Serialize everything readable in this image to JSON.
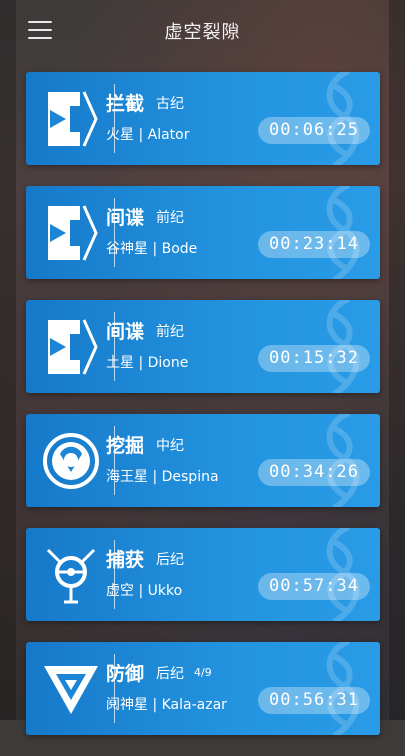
{
  "header": {
    "title": "虚空裂隙"
  },
  "colors": {
    "card": "#2394e0",
    "text": "#ffffff"
  },
  "missions": [
    {
      "type": "拦截",
      "era": "古纪",
      "progress": "",
      "location": "火星 | Alator",
      "timer": "00:06:25",
      "icon": "interception-icon"
    },
    {
      "type": "间谍",
      "era": "前纪",
      "progress": "",
      "location": "谷神星 | Bode",
      "timer": "00:23:14",
      "icon": "spy-icon"
    },
    {
      "type": "间谍",
      "era": "前纪",
      "progress": "",
      "location": "土星 | Dione",
      "timer": "00:15:32",
      "icon": "spy-icon"
    },
    {
      "type": "挖掘",
      "era": "中纪",
      "progress": "",
      "location": "海王星 | Despina",
      "timer": "00:34:26",
      "icon": "excavation-icon"
    },
    {
      "type": "捕获",
      "era": "后纪",
      "progress": "",
      "location": "虚空 | Ukko",
      "timer": "00:57:34",
      "icon": "capture-icon"
    },
    {
      "type": "防御",
      "era": "后纪",
      "progress": "4/9",
      "location": "阋神星 | Kala-azar",
      "timer": "00:56:31",
      "icon": "defense-icon"
    }
  ]
}
